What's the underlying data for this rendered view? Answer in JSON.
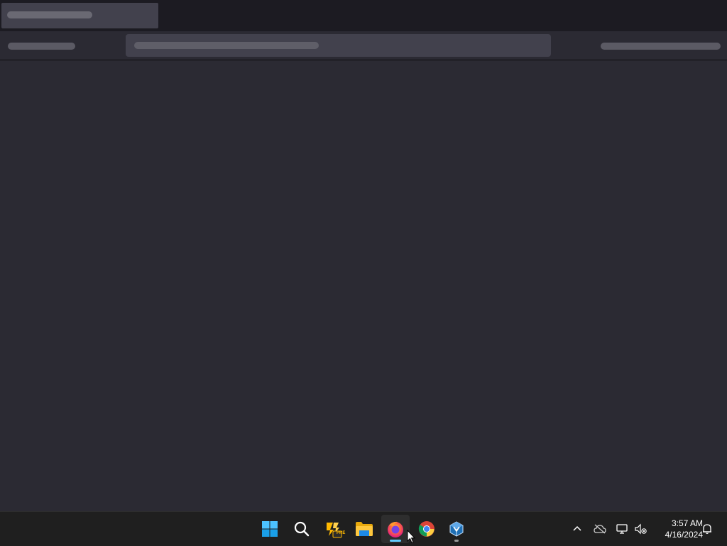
{
  "taskbar": {
    "apps": [
      {
        "name": "start",
        "icon": "windows-logo-icon"
      },
      {
        "name": "search",
        "icon": "search-icon"
      },
      {
        "name": "preview-app",
        "icon": "app-pre-icon",
        "badge": "PRE"
      },
      {
        "name": "file-explorer",
        "icon": "folder-icon"
      },
      {
        "name": "firefox",
        "icon": "firefox-icon",
        "active": true
      },
      {
        "name": "chrome",
        "icon": "chrome-icon"
      },
      {
        "name": "virtualbox",
        "icon": "virtualbox-icon",
        "running": true
      }
    ],
    "tray": {
      "icons": [
        "chevron-up-icon",
        "cloud-offline-icon",
        "network-icon",
        "volume-muted-icon"
      ]
    },
    "clock": {
      "time": "3:57 AM",
      "date": "4/16/2024"
    }
  },
  "colors": {
    "accent": "#60cdff",
    "background": "#2b2a33",
    "chrome": "#1c1b22"
  }
}
